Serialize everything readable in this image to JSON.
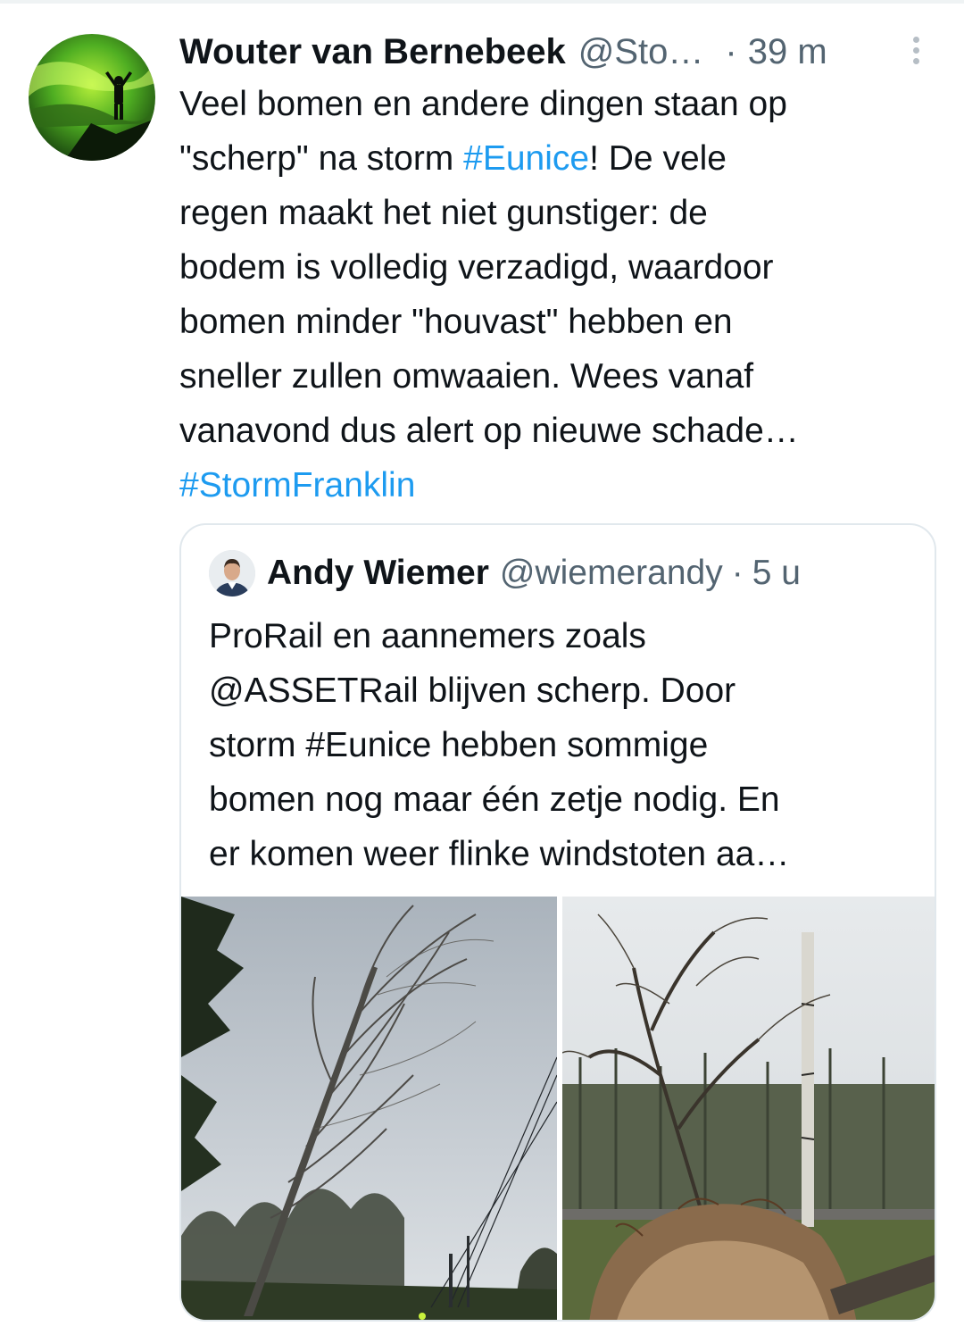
{
  "tweet": {
    "author_name": "Wouter van Bernebeek",
    "author_handle": "@Sto…",
    "separator": "·",
    "time": "39 m",
    "text_lines": [
      "Veel bomen en andere dingen staan op",
      "\"scherp\" na storm ",
      "#Eunice",
      "! De vele",
      "regen maakt het niet gunstiger: de",
      "bodem is volledig verzadigd, waardoor",
      "bomen minder \"houvast\" hebben en",
      "sneller zullen omwaaien. Wees vanaf",
      "vanavond dus alert op nieuwe schade…",
      "#StormFranklin"
    ]
  },
  "quote": {
    "author_name": "Andy Wiemer",
    "author_handle": "@wiemerandy",
    "separator": "·",
    "time": "5 u",
    "text_lines": [
      "ProRail en aannemers zoals",
      "@ASSETRail blijven scherp. Door",
      "storm #Eunice hebben sommige",
      "bomen nog maar één zetje nodig. En",
      "er komen weer flinke windstoten aa…"
    ]
  },
  "icons": {
    "more": "more-vertical-icon"
  },
  "colors": {
    "link": "#1d9bf0",
    "text": "#0f1419",
    "secondary": "#536471",
    "border": "#e1e8ed"
  }
}
